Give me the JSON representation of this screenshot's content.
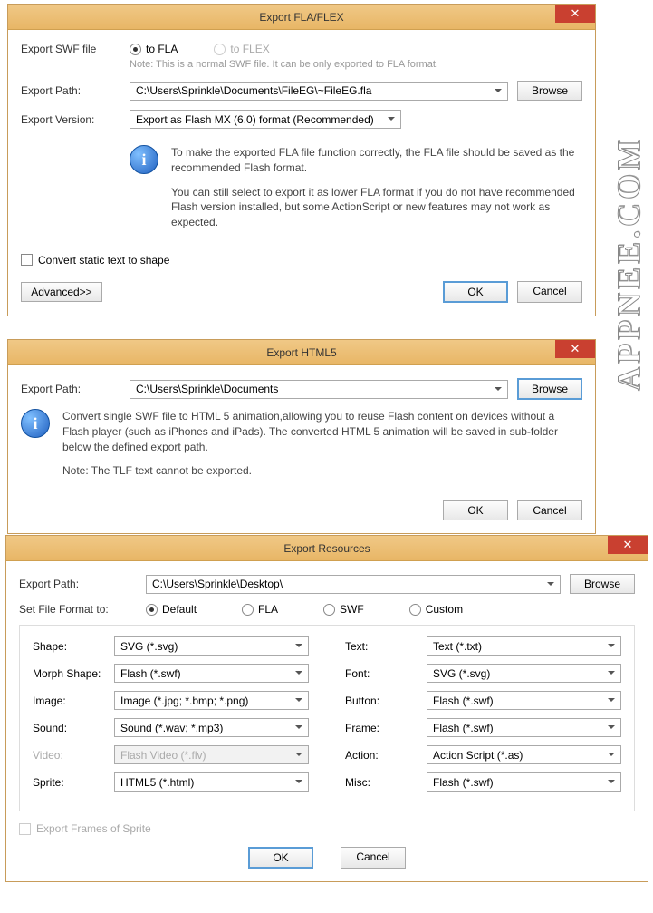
{
  "watermark": "APPNEE.COM",
  "dlg1": {
    "title": "Export FLA/FLEX",
    "swf_label": "Export SWF file",
    "to_fla": "to FLA",
    "to_flex": "to FLEX",
    "note": "Note: This is a normal SWF file. It can be only exported to FLA format.",
    "path_label": "Export Path:",
    "path_value": "C:\\Users\\Sprinkle\\Documents\\FileEG\\~FileEG.fla",
    "browse": "Browse",
    "version_label": "Export Version:",
    "version_value": "Export as Flash MX (6.0) format (Recommended)",
    "info1": "To make the exported FLA file function correctly, the FLA file should be saved as the recommended Flash format.",
    "info2": "You can still select to export it as lower FLA format if you do not have recommended Flash version installed, but some ActionScript or new features may not work as expected.",
    "convert_static": "Convert static text to shape",
    "advanced": "Advanced>>",
    "ok": "OK",
    "cancel": "Cancel"
  },
  "dlg2": {
    "title": "Export HTML5",
    "path_label": "Export Path:",
    "path_value": "C:\\Users\\Sprinkle\\Documents",
    "browse": "Browse",
    "info1": "Convert single SWF file to HTML 5 animation,allowing you to reuse Flash content on devices without a Flash player (such as iPhones and iPads). The converted HTML 5 animation will be  saved in sub-folder below the defined export path.",
    "info2": "Note: The TLF text cannot be exported.",
    "ok": "OK",
    "cancel": "Cancel"
  },
  "dlg3": {
    "title": "Export  Resources",
    "path_label": "Export Path:",
    "path_value": "C:\\Users\\Sprinkle\\Desktop\\",
    "browse": "Browse",
    "format_label": "Set File Format to:",
    "opt_default": "Default",
    "opt_fla": "FLA",
    "opt_swf": "SWF",
    "opt_custom": "Custom",
    "shape": {
      "label": "Shape:",
      "value": "SVG (*.svg)"
    },
    "morph": {
      "label": "Morph Shape:",
      "value": "Flash (*.swf)"
    },
    "image": {
      "label": "Image:",
      "value": "Image (*.jpg; *.bmp; *.png)"
    },
    "sound": {
      "label": "Sound:",
      "value": "Sound (*.wav; *.mp3)"
    },
    "video": {
      "label": "Video:",
      "value": "Flash Video (*.flv)"
    },
    "sprite": {
      "label": "Sprite:",
      "value": "HTML5 (*.html)"
    },
    "text": {
      "label": "Text:",
      "value": "Text (*.txt)"
    },
    "font": {
      "label": "Font:",
      "value": "SVG (*.svg)"
    },
    "button": {
      "label": "Button:",
      "value": "Flash (*.swf)"
    },
    "frame": {
      "label": "Frame:",
      "value": "Flash (*.swf)"
    },
    "action": {
      "label": "Action:",
      "value": "Action Script (*.as)"
    },
    "misc": {
      "label": "Misc:",
      "value": "Flash (*.swf)"
    },
    "export_frames": "Export Frames of Sprite",
    "ok": "OK",
    "cancel": "Cancel"
  }
}
